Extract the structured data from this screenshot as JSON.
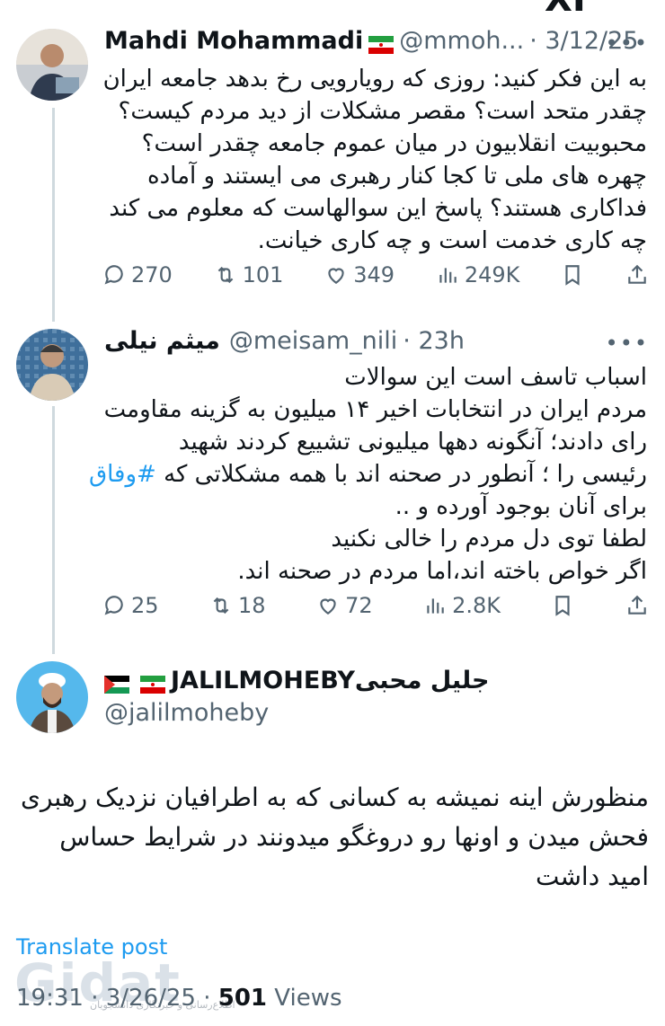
{
  "tweets": [
    {
      "name": "Mahdi Mohammadi",
      "handle": "@mmoh...",
      "time": "· 3/12/25",
      "lines": [
        "به این فکر کنید: روزی که رویارویی رخ بدهد  جامعه ایران",
        "چقدر متحد است؟  مقصر مشکلات از دید مردم کیست؟",
        "محبوبیت انقلابیون در میان عموم جامعه چقدر است؟",
        "چهره های ملی تا کجا کنار رهبری می ایستند و آماده",
        "فداکاری هستند؟ پاسخ این سوالهاست که معلوم می کند",
        "چه کاری خدمت است و چه کاری خیانت."
      ],
      "replies": "270",
      "reposts": "101",
      "likes": "349",
      "views": "249K"
    },
    {
      "name": "میثم نیلی",
      "handle": "@meisam_nili",
      "time": "· 23h",
      "lines": [
        "اسباب تاسف است این سوالات",
        "مردم ایران در انتخابات اخیر ۱۴ میلیون به گزینه مقاومت",
        "رای دادند؛ آنگونه دهها میلیونی تشییع کردند شهید",
        "رئیسی را ؛ آنطور در صحنه اند با همه مشکلاتی که",
        "برای آنان بوجود آورده و ..",
        "لطفا توی دل مردم را خالی نکنید",
        "اگر خواص باخته اند،اما مردم در صحنه اند."
      ],
      "hashtag": "#وفاق",
      "replies": "25",
      "reposts": "18",
      "likes": "72",
      "views": "2.8K"
    }
  ],
  "main": {
    "name": "جلیل محبیJALILMOHEBY",
    "handle": "@jalilmoheby",
    "lines": [
      "منظورش اینه نمیشه به کسانی که به اطرافیان نزدیک رهبری",
      "فحش میدن و اونها رو دروغگو میدونند در شرایط حساس",
      "امید داشت"
    ],
    "translate": "Translate post",
    "time": "19:31 · 3/26/25 · ",
    "views_count": "501",
    "views_label": " Views"
  },
  "watermark": "Gidat",
  "watermark_sub": "اطلاع‌رسانی و خبرنگاری دانشجویان",
  "top_cut": "XI",
  "icons": [
    "reply-icon",
    "repost-icon",
    "like-icon",
    "views-icon",
    "bookmark-icon",
    "share-icon",
    "more-icon"
  ],
  "colors": {
    "link": "#1d9bf0",
    "muted": "#536471",
    "text": "#0f1419"
  }
}
